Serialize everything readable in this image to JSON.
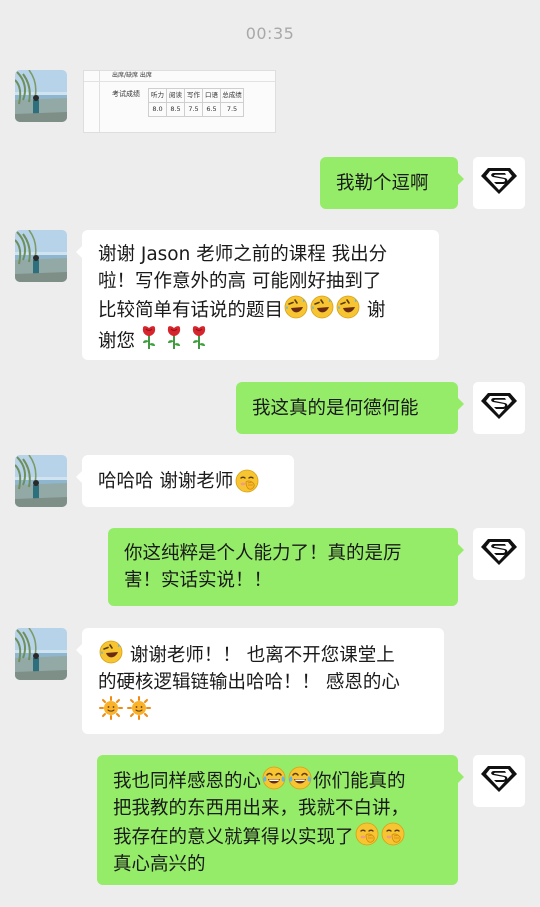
{
  "timestamp": "00:35",
  "messages": [
    {
      "from": "student",
      "type": "image",
      "image_alt": "score report"
    },
    {
      "from": "teacher",
      "text": "我勒个逗啊"
    },
    {
      "from": "student",
      "lines": [
        {
          "text": "谢谢 Jason 老师之前的课程 我出分"
        },
        {
          "text": "啦！写作意外的高 可能刚好抽到了"
        },
        {
          "text": "比较简单有话说的题目",
          "emoji_after": [
            "rofl",
            "rofl",
            "rofl"
          ],
          "tail": " 谢"
        },
        {
          "text": "谢您",
          "emoji_after": [
            "rose",
            "rose",
            "rose"
          ]
        }
      ]
    },
    {
      "from": "teacher",
      "text": "我这真的是何德何能"
    },
    {
      "from": "student",
      "text": "哈哈哈 谢谢老师",
      "emoji_after": [
        "hiding-smile"
      ]
    },
    {
      "from": "teacher",
      "lines": [
        {
          "text": "你这纯粹是个人能力了！真的是厉"
        },
        {
          "text": "害！实话实说！！"
        }
      ]
    },
    {
      "from": "student",
      "lines": [
        {
          "emoji_before": [
            "rofl"
          ],
          "text": " 谢谢老师！！ 也离不开您课堂上"
        },
        {
          "text": "的硬核逻辑链输出哈哈！！ 感恩的心"
        },
        {
          "emoji_after": [
            "sun",
            "sun"
          ]
        }
      ]
    },
    {
      "from": "teacher",
      "lines": [
        {
          "text": "我也同样感恩的心",
          "emoji_after": [
            "tears-of-joy",
            "tears-of-joy"
          ],
          "tail": "你们能真的"
        },
        {
          "text": "把我教的东西用出来，我就不白讲，"
        },
        {
          "text": "我存在的意义就算得以实现了",
          "emoji_after": [
            "hiding-smile",
            "hiding-smile"
          ]
        },
        {
          "text": "真心高兴的"
        }
      ]
    }
  ],
  "scorecard": {
    "strip_text": "出席/缺席  出席",
    "label": "考试成绩",
    "headers": [
      "听力",
      "阅读",
      "写作",
      "口语",
      "总成绩"
    ],
    "scores": [
      "8.0",
      "8.5",
      "7.5",
      "6.5",
      "7.5"
    ]
  },
  "colors": {
    "background": "#ededed",
    "outgoing_bubble": "#95ec69",
    "incoming_bubble": "#ffffff",
    "timestamp": "#a8a8a8"
  }
}
